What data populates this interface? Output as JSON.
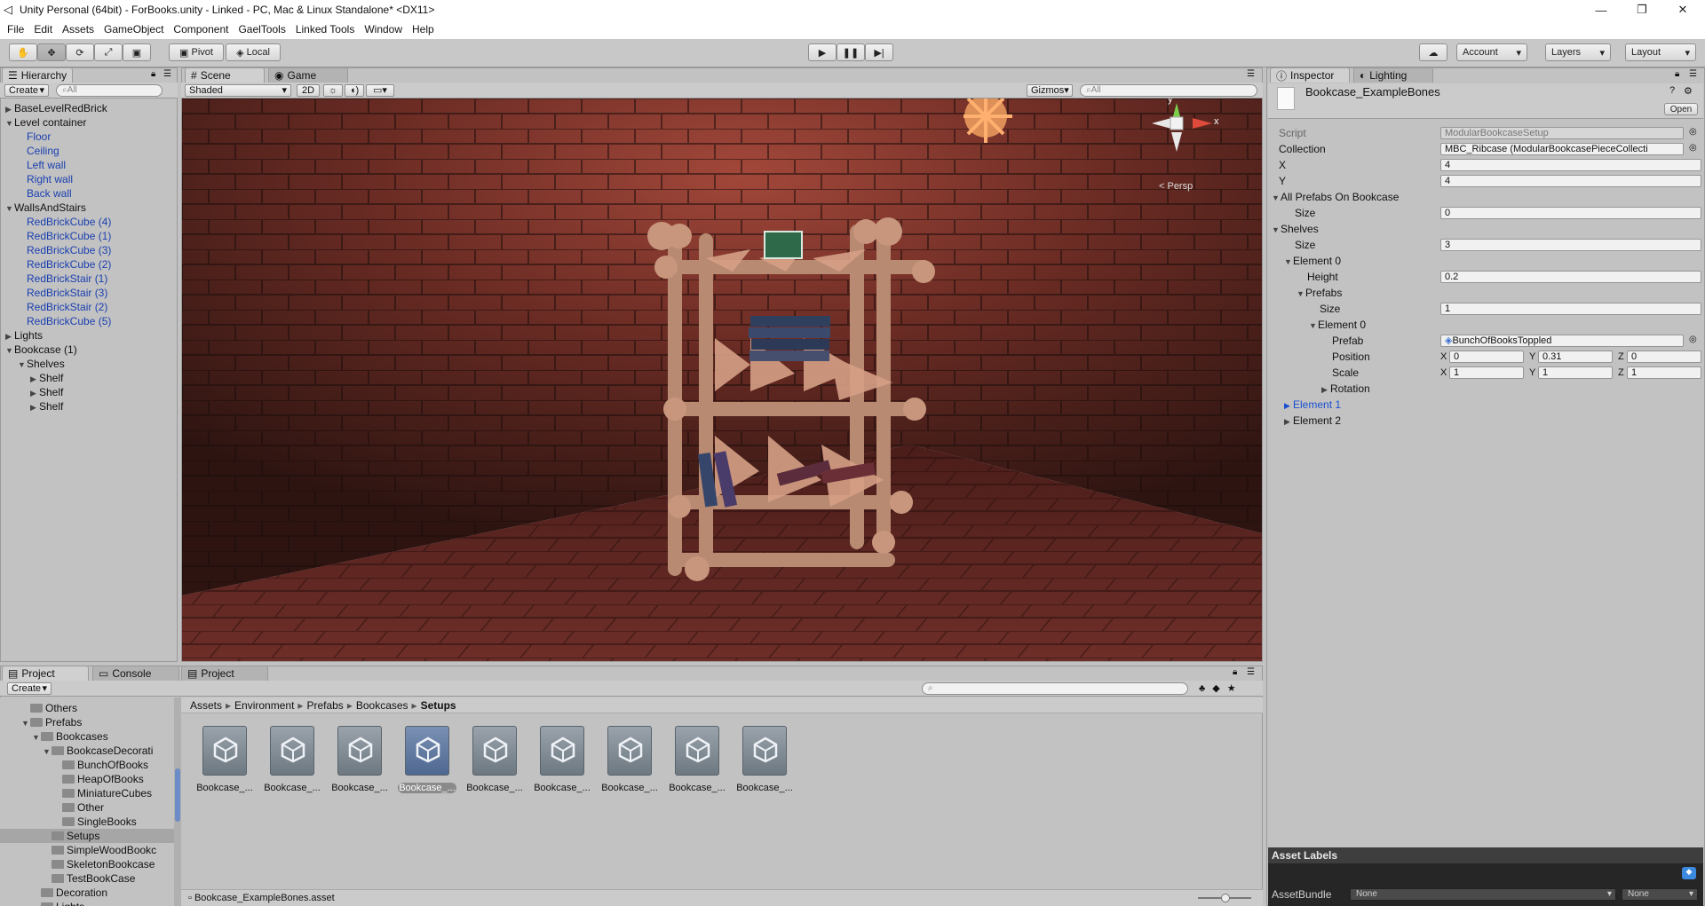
{
  "window": {
    "title": "Unity Personal (64bit) - ForBooks.unity - Linked - PC, Mac & Linux Standalone* <DX11>"
  },
  "menu": [
    "File",
    "Edit",
    "Assets",
    "GameObject",
    "Component",
    "GaelTools",
    "Linked Tools",
    "Window",
    "Help"
  ],
  "toolbar": {
    "pivot": "Pivot",
    "local": "Local",
    "account": "Account",
    "layers": "Layers",
    "layout": "Layout"
  },
  "hierarchy": {
    "tab": "Hierarchy",
    "create": "Create",
    "search_placeholder": "All",
    "items": [
      {
        "label": "BaseLevelRedBrick",
        "depth": 0,
        "arrow": "▶",
        "blue": false
      },
      {
        "label": "Level container",
        "depth": 0,
        "arrow": "▼",
        "blue": false
      },
      {
        "label": "Floor",
        "depth": 1,
        "arrow": "",
        "blue": true
      },
      {
        "label": "Ceiling",
        "depth": 1,
        "arrow": "",
        "blue": true
      },
      {
        "label": "Left wall",
        "depth": 1,
        "arrow": "",
        "blue": true
      },
      {
        "label": "Right wall",
        "depth": 1,
        "arrow": "",
        "blue": true
      },
      {
        "label": "Back wall",
        "depth": 1,
        "arrow": "",
        "blue": true
      },
      {
        "label": "WallsAndStairs",
        "depth": 0,
        "arrow": "▼",
        "blue": false
      },
      {
        "label": "RedBrickCube (4)",
        "depth": 1,
        "arrow": "",
        "blue": true
      },
      {
        "label": "RedBrickCube (1)",
        "depth": 1,
        "arrow": "",
        "blue": true
      },
      {
        "label": "RedBrickCube (3)",
        "depth": 1,
        "arrow": "",
        "blue": true
      },
      {
        "label": "RedBrickCube (2)",
        "depth": 1,
        "arrow": "",
        "blue": true
      },
      {
        "label": "RedBrickStair (1)",
        "depth": 1,
        "arrow": "",
        "blue": true
      },
      {
        "label": "RedBrickStair (3)",
        "depth": 1,
        "arrow": "",
        "blue": true
      },
      {
        "label": "RedBrickStair (2)",
        "depth": 1,
        "arrow": "",
        "blue": true
      },
      {
        "label": "RedBrickCube (5)",
        "depth": 1,
        "arrow": "",
        "blue": true
      },
      {
        "label": "Lights",
        "depth": 0,
        "arrow": "▶",
        "blue": false
      },
      {
        "label": "Bookcase (1)",
        "depth": 0,
        "arrow": "▼",
        "blue": false
      },
      {
        "label": "Shelves",
        "depth": 1,
        "arrow": "▼",
        "blue": false
      },
      {
        "label": "Shelf",
        "depth": 2,
        "arrow": "▶",
        "blue": false
      },
      {
        "label": "Shelf",
        "depth": 2,
        "arrow": "▶",
        "blue": false
      },
      {
        "label": "Shelf",
        "depth": 2,
        "arrow": "▶",
        "blue": false
      }
    ]
  },
  "scene": {
    "tab_scene": "Scene",
    "tab_game": "Game",
    "shading": "Shaded",
    "mode_2d": "2D",
    "gizmos": "Gizmos",
    "search_placeholder": "All",
    "persp": "< Persp",
    "axis_y": "y",
    "axis_x": "x"
  },
  "inspector": {
    "tab": "Inspector",
    "tab_lighting": "Lighting",
    "asset_name": "Bookcase_ExampleBones",
    "open": "Open",
    "script_label": "Script",
    "script_value": "ModularBookcaseSetup",
    "collection_label": "Collection",
    "collection_value": "MBC_Ribcase (ModularBookcasePieceCollecti",
    "x_label": "X",
    "x_value": "4",
    "y_label": "Y",
    "y_value": "4",
    "all_prefabs": "All Prefabs On Bookcase",
    "size": "Size",
    "all_size": "0",
    "shelves": "Shelves",
    "shelves_size": "3",
    "element0": "Element 0",
    "height_label": "Height",
    "height_value": "0.2",
    "prefabs": "Prefabs",
    "prefabs_size": "1",
    "inner_element0": "Element 0",
    "prefab_label": "Prefab",
    "prefab_value": "BunchOfBooksToppled",
    "position_label": "Position",
    "pos_x": "0",
    "pos_y": "0.31",
    "pos_z": "0",
    "scale_label": "Scale",
    "scale_x": "1",
    "scale_y": "1",
    "scale_z": "1",
    "rotation_label": "Rotation",
    "element1": "Element 1",
    "element2": "Element 2",
    "xyz": [
      "X",
      "Y",
      "Z"
    ],
    "asset_labels": "Asset Labels",
    "assetbundle_label": "AssetBundle",
    "assetbundle_value": "None",
    "assetbundle_variant": "None"
  },
  "project": {
    "tab_project": "Project",
    "tab_console": "Console",
    "tab_project2": "Project",
    "create": "Create",
    "tree": [
      {
        "label": "Others",
        "depth": 2,
        "arrow": ""
      },
      {
        "label": "Prefabs",
        "depth": 2,
        "arrow": "▼"
      },
      {
        "label": "Bookcases",
        "depth": 3,
        "arrow": "▼"
      },
      {
        "label": "BookcaseDecorati",
        "depth": 4,
        "arrow": "▼"
      },
      {
        "label": "BunchOfBooks",
        "depth": 5,
        "arrow": ""
      },
      {
        "label": "HeapOfBooks",
        "depth": 5,
        "arrow": ""
      },
      {
        "label": "MiniatureCubes",
        "depth": 5,
        "arrow": ""
      },
      {
        "label": "Other",
        "depth": 5,
        "arrow": ""
      },
      {
        "label": "SingleBooks",
        "depth": 5,
        "arrow": ""
      },
      {
        "label": "Setups",
        "depth": 4,
        "arrow": "",
        "selected": true
      },
      {
        "label": "SimpleWoodBookc",
        "depth": 4,
        "arrow": ""
      },
      {
        "label": "SkeletonBookcase",
        "depth": 4,
        "arrow": ""
      },
      {
        "label": "TestBookCase",
        "depth": 4,
        "arrow": ""
      },
      {
        "label": "Decoration",
        "depth": 3,
        "arrow": ""
      },
      {
        "label": "Lights",
        "depth": 3,
        "arrow": ""
      }
    ],
    "breadcrumb": [
      "Assets",
      "Environment",
      "Prefabs",
      "Bookcases",
      "Setups"
    ],
    "assets": [
      "Bookcase_...",
      "Bookcase_...",
      "Bookcase_...",
      "Bookcase_...",
      "Bookcase_...",
      "Bookcase_...",
      "Bookcase_...",
      "Bookcase_...",
      "Bookcase_..."
    ],
    "selected_index": 3,
    "status_file": "Bookcase_ExampleBones.asset"
  }
}
